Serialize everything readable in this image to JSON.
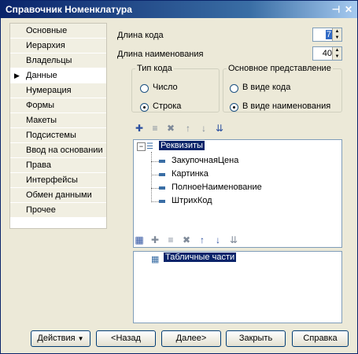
{
  "window": {
    "title": "Справочник Номенклатура",
    "pin_icon": "pin-icon",
    "close_icon": "close-icon"
  },
  "sidebar": {
    "items": [
      {
        "label": "Основные"
      },
      {
        "label": "Иерархия"
      },
      {
        "label": "Владельцы"
      },
      {
        "label": "Данные",
        "active": true
      },
      {
        "label": "Нумерация"
      },
      {
        "label": "Формы"
      },
      {
        "label": "Макеты"
      },
      {
        "label": "Подсистемы"
      },
      {
        "label": "Ввод на основании"
      },
      {
        "label": "Права"
      },
      {
        "label": "Интерфейсы"
      },
      {
        "label": "Обмен данными"
      },
      {
        "label": "Прочее"
      }
    ]
  },
  "data": {
    "code_length_label": "Длина кода",
    "code_length_value": "7",
    "name_length_label": "Длина наименования",
    "name_length_value": "40",
    "code_type": {
      "legend": "Тип кода",
      "options": [
        "Число",
        "Строка"
      ],
      "selected": "Строка"
    },
    "main_repr": {
      "legend": "Основное представление",
      "options": [
        "В виде кода",
        "В виде наименования"
      ],
      "selected": "В виде наименования"
    },
    "attributes_tree": {
      "root": "Реквизиты",
      "children": [
        "ЗакупочнаяЦена",
        "Картинка",
        "ПолноеНаименование",
        "ШтрихКод"
      ]
    },
    "tabular_tree": {
      "root": "Табличные части"
    }
  },
  "buttons": {
    "actions": "Действия",
    "back": "<Назад",
    "next": "Далее>",
    "close": "Закрыть",
    "help": "Справка"
  }
}
